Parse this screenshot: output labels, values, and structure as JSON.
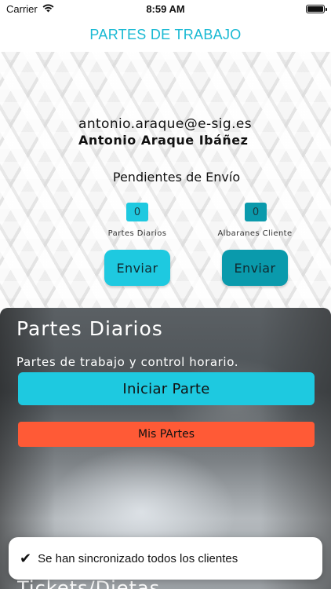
{
  "status_bar": {
    "carrier": "Carrier",
    "time": "8:59 AM"
  },
  "nav": {
    "title": "PARTES DE TRABAJO"
  },
  "user": {
    "email": "antonio.araque@e-sig.es",
    "name": "Antonio Araque Ibáñez"
  },
  "pending": {
    "title": "Pendientes de Envío",
    "partes": {
      "count": "0",
      "label": "Partes Diarios",
      "button": "Enviar"
    },
    "albaranes": {
      "count": "0",
      "label": "Albaranes Cliente",
      "button": "Enviar"
    }
  },
  "daily_section": {
    "title": "Partes Diarios",
    "subtitle": "Partes de trabajo y control horario.",
    "start_button": "Iniciar Parte",
    "my_button": "Mis PArtes"
  },
  "next_section": {
    "title": "Tickets/Dietas"
  },
  "toast": {
    "icon": "checkmark-icon",
    "text": "Se han sincronizado todos los clientes"
  },
  "colors": {
    "accent": "#1ec9e0",
    "accent_dark": "#0a9aac",
    "danger": "#ff5a36",
    "title": "#19b9d3"
  }
}
